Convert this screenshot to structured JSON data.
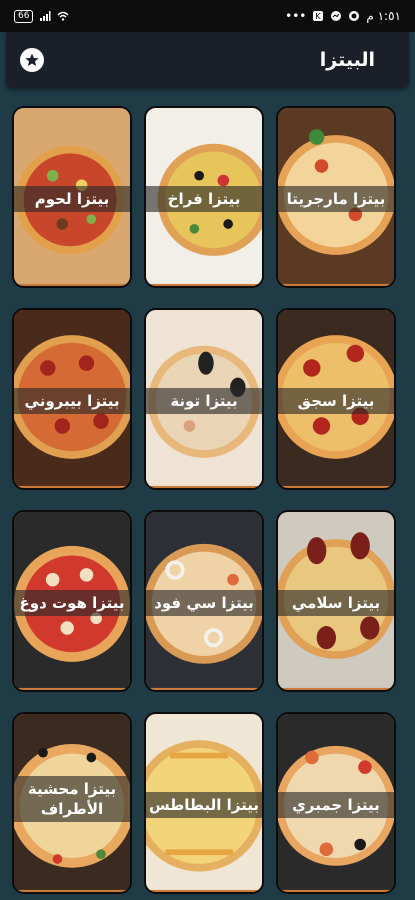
{
  "status_bar": {
    "time": "١:٥١ م",
    "battery": "66"
  },
  "appbar": {
    "title": "البيتزا"
  },
  "items": [
    {
      "label": "بيتزا لحوم"
    },
    {
      "label": "بيتزا فراخ"
    },
    {
      "label": "بيتزا مارجريتا"
    },
    {
      "label": "بيتزا بيبروني"
    },
    {
      "label": "بيتزا تونة"
    },
    {
      "label": "بيتزا سجق"
    },
    {
      "label": "بيتزا هوت دوغ"
    },
    {
      "label": "بيتزا سي فود"
    },
    {
      "label": "بيتزا سلامي"
    },
    {
      "label": "بيتزا محشية الأطراف"
    },
    {
      "label": "بيتزا البطاطس"
    },
    {
      "label": "بيتزا جمبري"
    }
  ],
  "colors": {
    "background": "#1f3b45",
    "appbar": "#1b1f2a",
    "statusbar": "#0d0d0d"
  },
  "icons": {
    "favorite": "star-icon"
  }
}
